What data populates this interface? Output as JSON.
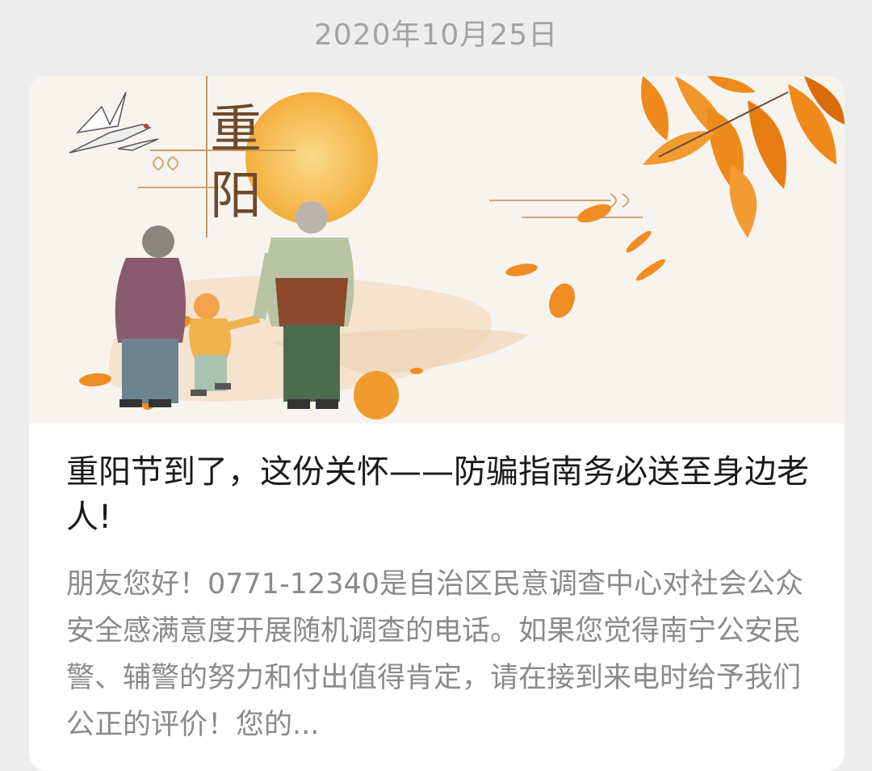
{
  "message": {
    "date": "2020年10月25日",
    "article": {
      "cover": {
        "art_text": "重阳",
        "illustration": "chongyang-festival-elderly-couple-with-child"
      },
      "title": "重阳节到了，这份关怀——防骗指南务必送至身边老人!",
      "digest": "朋友您好！0771-12340是自治区民意调查中心对社会公众安全感满意度开展随机调查的电话。如果您觉得南宁公安民警、辅警的努力和付出值得肯定，请在接到来电时给予我们公正的评价！您的..."
    }
  },
  "colors": {
    "background": "#ededed",
    "card": "#ffffff",
    "date_text": "#a3a3a3",
    "title_text": "#1a1a1a",
    "digest_text": "#8a8a8a",
    "sun": "#f7c25a",
    "leaf": "#ee8a1c"
  }
}
